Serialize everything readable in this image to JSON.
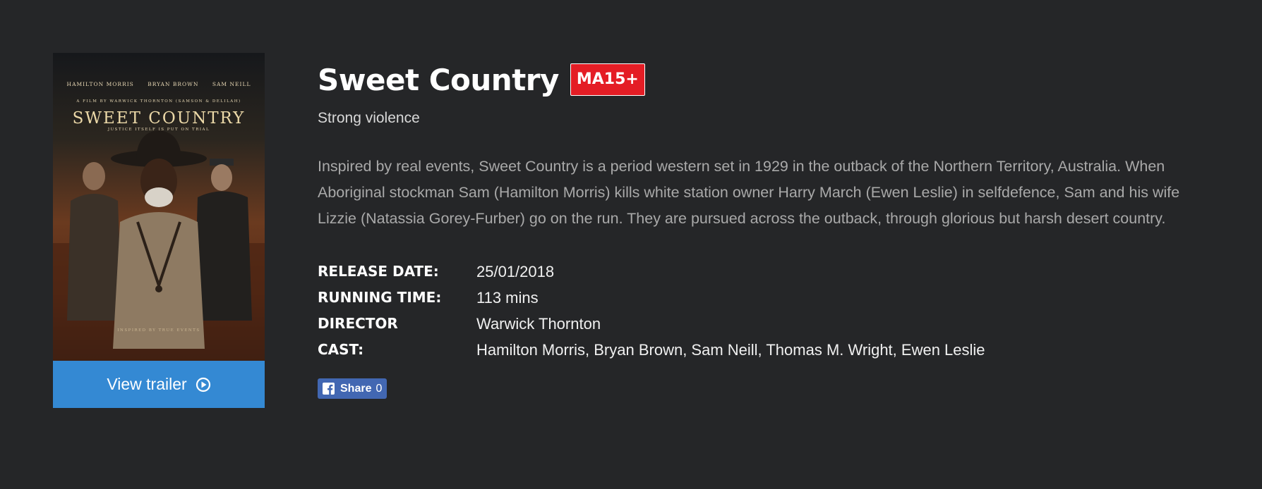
{
  "poster": {
    "actors": [
      "HAMILTON MORRIS",
      "BRYAN BROWN",
      "SAM NEILL"
    ],
    "credit": "A FILM BY WARWICK THORNTON (SAMSON & DELILAH)",
    "title": "SWEET COUNTRY",
    "tagline": "JUSTICE ITSELF IS PUT ON TRIAL",
    "bottom": "INSPIRED BY TRUE EVENTS",
    "trailer_label": "View trailer",
    "trailer_icon": "play-circle-icon"
  },
  "movie": {
    "title": "Sweet Country",
    "rating": "MA15+",
    "rating_color": "#e41d25",
    "rating_reason": "Strong violence",
    "synopsis": "Inspired by real events, Sweet Country is a period western set in 1929 in the outback of the Northern Territory, Australia. When Aboriginal stockman Sam (Hamilton Morris) kills white station owner Harry March (Ewen Leslie) in selfdefence, Sam and his wife Lizzie (Natassia Gorey-Furber) go on the run. They are pursued across the outback, through glorious but harsh desert country."
  },
  "details": [
    {
      "label": "RELEASE DATE:",
      "value": "25/01/2018"
    },
    {
      "label": "RUNNING TIME:",
      "value": "113 mins"
    },
    {
      "label": "DIRECTOR",
      "value": "Warwick Thornton"
    },
    {
      "label": "CAST:",
      "value": "Hamilton Morris, Bryan Brown, Sam Neill, Thomas M. Wright, Ewen Leslie"
    }
  ],
  "share": {
    "label": "Share",
    "count": "0",
    "icon": "facebook-icon",
    "color": "#4267b2"
  },
  "colors": {
    "background": "#252628",
    "accent": "#3489d3"
  }
}
